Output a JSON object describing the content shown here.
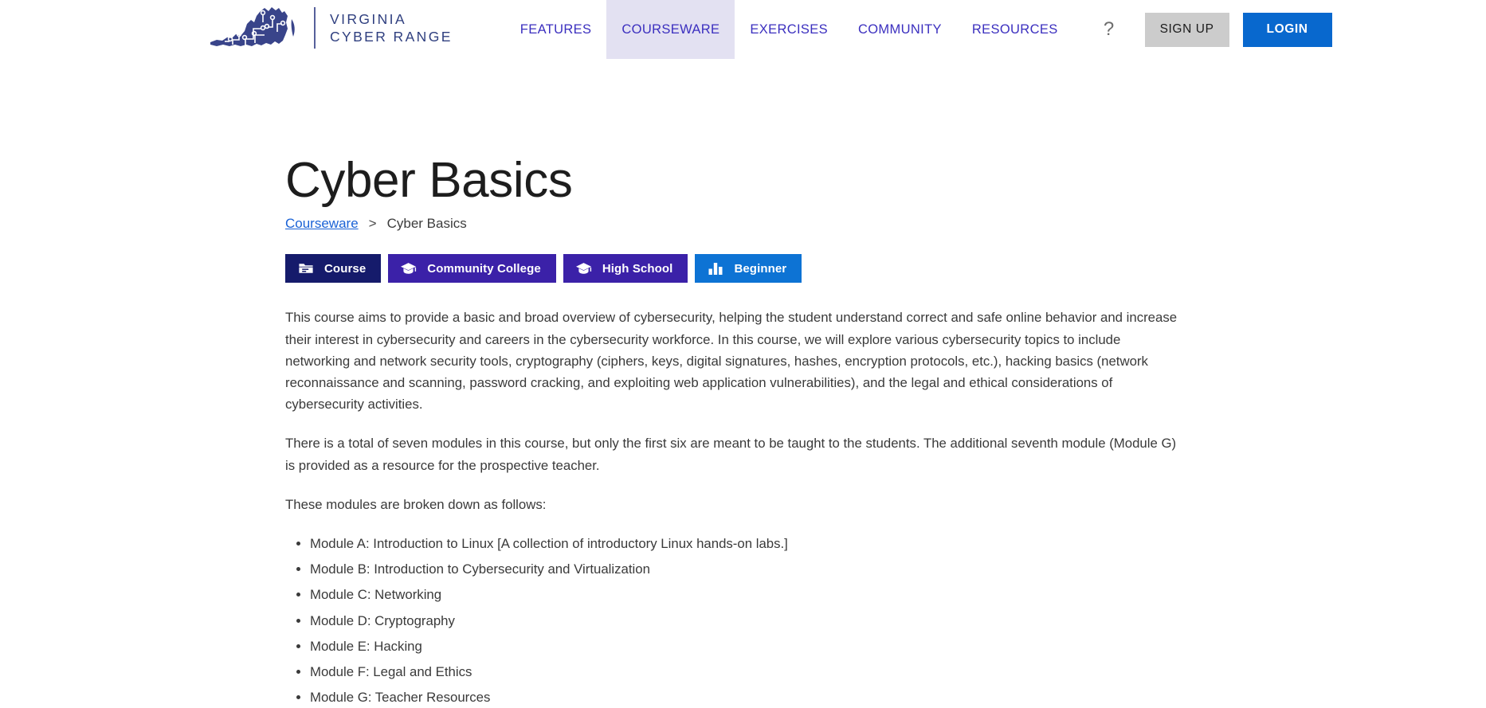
{
  "header": {
    "logo": {
      "icon": "virginia-state-outline-circuit-icon",
      "line1": "VIRGINIA",
      "line2": "CYBER RANGE"
    },
    "nav": [
      {
        "label": "FEATURES",
        "active": false
      },
      {
        "label": "COURSEWARE",
        "active": true
      },
      {
        "label": "EXERCISES",
        "active": false
      },
      {
        "label": "COMMUNITY",
        "active": false
      },
      {
        "label": "RESOURCES",
        "active": false
      }
    ],
    "help_icon": "?",
    "signup_label": "SIGN UP",
    "login_label": "LOGIN",
    "colors": {
      "nav_text": "#3b2fbf",
      "nav_active_bg": "#e3e1f2",
      "logo_blue": "#2f3f7f",
      "signup_bg": "#cccccc",
      "login_bg": "#0868ce"
    }
  },
  "main": {
    "title": "Cyber Basics",
    "breadcrumb": {
      "parent_label": "Courseware",
      "separator": ">",
      "current_label": "Cyber Basics"
    },
    "badges": [
      {
        "label": "Course",
        "icon": "folder-icon",
        "color": "#151b6b"
      },
      {
        "label": "Community College",
        "icon": "graduation-cap-icon",
        "color": "#3b21a8"
      },
      {
        "label": "High School",
        "icon": "graduation-cap-icon",
        "color": "#3b21a8"
      },
      {
        "label": "Beginner",
        "icon": "bar-chart-icon",
        "color": "#0d73d4"
      }
    ],
    "paragraphs": [
      "This course aims to provide a basic and broad overview of cybersecurity, helping the student understand correct and safe online behavior and increase their interest in cybersecurity and careers in the cybersecurity workforce. In this course, we will explore various cybersecurity topics to include networking and network security tools, cryptography (ciphers, keys, digital signatures, hashes, encryption protocols, etc.), hacking basics (network reconnaissance and scanning, password cracking, and exploiting web application vulnerabilities), and the legal and ethical considerations of cybersecurity activities.",
      "There is a total of seven modules in this course, but only the first six are meant to be taught to the students. The additional seventh module (Module G) is provided as a resource for the prospective teacher.",
      "These modules are broken down as follows:"
    ],
    "modules": [
      "Module A: Introduction to Linux [A collection of introductory Linux hands-on labs.]",
      "Module B: Introduction to Cybersecurity and Virtualization",
      "Module C: Networking",
      "Module D: Cryptography",
      "Module E: Hacking",
      "Module F: Legal and Ethics",
      "Module G: Teacher Resources"
    ]
  }
}
